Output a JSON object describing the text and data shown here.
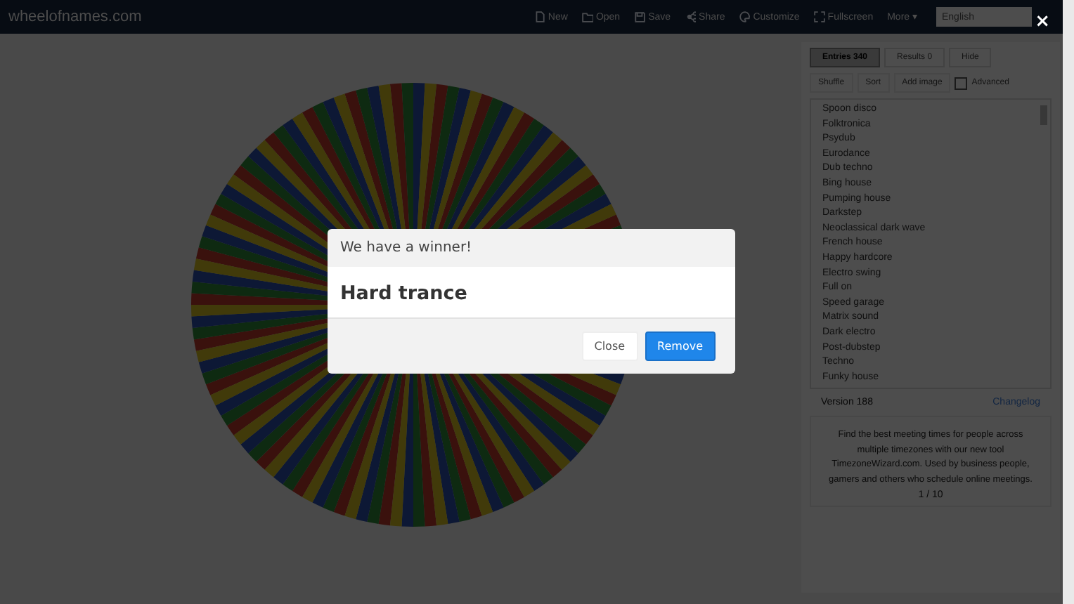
{
  "nav": {
    "logo": "wheelofnames.com",
    "items": [
      {
        "label": "New"
      },
      {
        "label": "Open"
      },
      {
        "label": "Save"
      },
      {
        "label": "Share"
      },
      {
        "label": "Customize"
      },
      {
        "label": "Fullscreen"
      },
      {
        "label": "More"
      }
    ],
    "more_caret": "▾",
    "language": "English"
  },
  "overlay_close": "×",
  "tabs": [
    {
      "label": "Entries",
      "count": "340",
      "selected": true
    },
    {
      "label": "Results",
      "count": "0",
      "selected": false
    }
  ],
  "hide": "Hide",
  "tools": [
    "Shuffle",
    "Sort",
    "Add image"
  ],
  "advanced": {
    "label": "Advanced",
    "checked": false
  },
  "entries": [
    "Spoon disco",
    "Folktronica",
    "Psydub",
    "Eurodance",
    "Dub techno",
    "Bing house",
    "Pumping house",
    "Darkstep",
    "Neoclassical dark wave",
    "French house",
    "Happy hardcore",
    "Electro swing",
    "Full on",
    "Speed garage",
    "Matrix sound",
    "Dark electro",
    "Post-dubstep",
    "Techno",
    "Funky house"
  ],
  "version": "Version 188",
  "changelog": "Changelog",
  "promo": "Find the best meeting times for people across multiple timezones with our new tool TimezoneWizard.com. Used by business people, gamers and others who schedule online meetings.",
  "pager": "1 / 10",
  "dialog": {
    "title": "We have a winner!",
    "winner": "Hard trance",
    "buttons": [
      {
        "label": "Close",
        "kind": "secondary"
      },
      {
        "label": "Remove",
        "kind": "primary"
      }
    ]
  }
}
